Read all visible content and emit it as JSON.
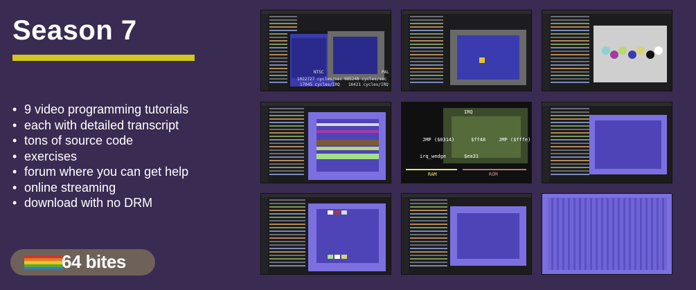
{
  "title": "Season 7",
  "features": [
    "9 video programming tutorials",
    "each with detailed transcript",
    "tons of source code",
    "exercises",
    "forum where you can get help",
    "online streaming",
    "download with no DRM"
  ],
  "logo": {
    "text": "64 bites",
    "stripe_colors": [
      "#c8392b",
      "#e07b28",
      "#e6c527",
      "#5aa63a",
      "#2d7fb8"
    ]
  },
  "thumbnails": {
    "t1": {
      "ntsc_label": "NTSC",
      "pal_label": "PAL",
      "ntsc_cycles": "1022727 cycles/sec",
      "ntsc_irq": "17045 cycles/IRQ",
      "pal_cycles": "985248 cycles/sec",
      "pal_irq": "16421 cycles/IRQ"
    },
    "t5": {
      "irq": "IRQ",
      "jmp_0314": "JMP ($0314)",
      "ff48": "$ff48",
      "jmp_fffe": "JMP ($fffe)",
      "irq_wedge": "irq_wedge",
      "ea31": "$ea31",
      "ram": "RAM",
      "rom": "ROM"
    }
  }
}
